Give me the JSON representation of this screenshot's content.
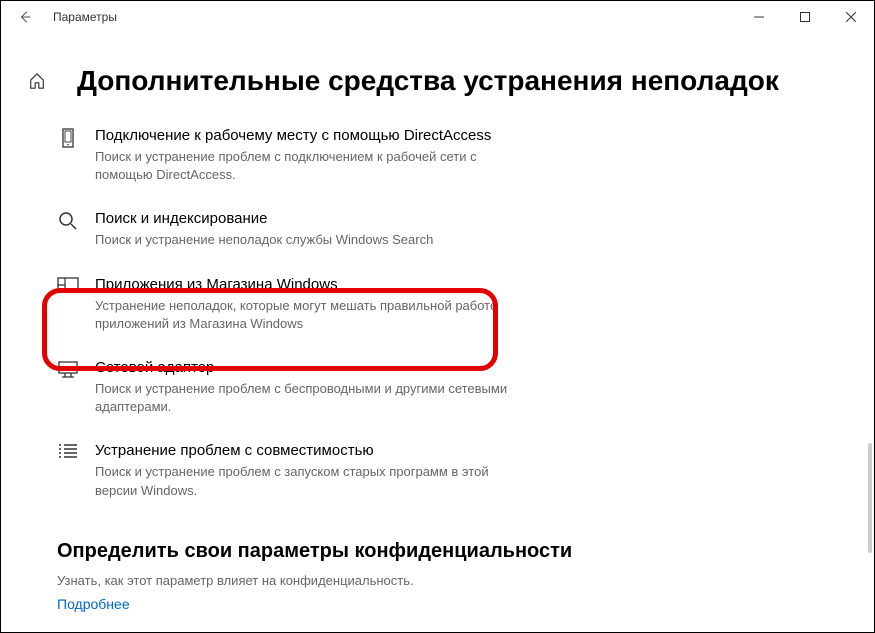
{
  "titlebar": {
    "title": "Параметры"
  },
  "page": {
    "heading": "Дополнительные средства устранения неполадок"
  },
  "items": [
    {
      "title": "Подключение к рабочему месту с помощью DirectAccess",
      "desc": "Поиск и устранение проблем с подключением к рабочей сети с помощью DirectAccess."
    },
    {
      "title": "Поиск и индексирование",
      "desc": "Поиск и устранение неполадок службы Windows Search"
    },
    {
      "title": "Приложения из Магазина Windows",
      "desc": "Устранение неполадок, которые могут мешать правильной работе приложений из Магазина Windows"
    },
    {
      "title": "Сетевой адаптер",
      "desc": "Поиск и устранение проблем с беспроводными и другими сетевыми адаптерами."
    },
    {
      "title": "Устранение проблем с совместимостью",
      "desc": "Поиск и устранение проблем с запуском старых программ в этой версии Windows."
    }
  ],
  "privacy": {
    "heading": "Определить свои параметры конфиденциальности",
    "subtext": "Узнать, как этот параметр влияет на конфиденциальность.",
    "link": "Подробнее"
  }
}
